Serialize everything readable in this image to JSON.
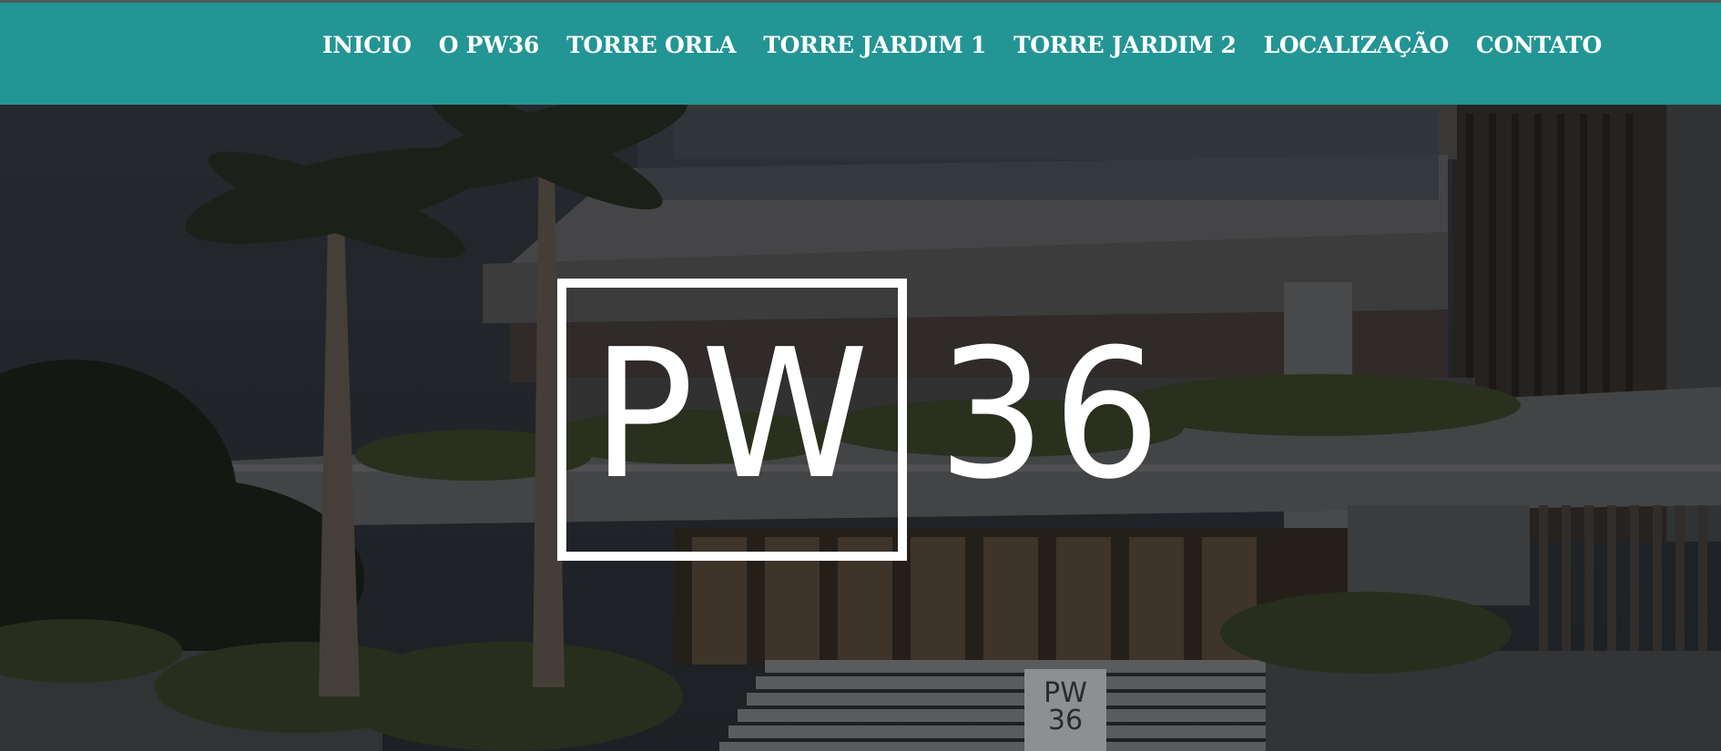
{
  "nav": {
    "items": [
      {
        "label": "INICIO"
      },
      {
        "label": "O PW36"
      },
      {
        "label": "TORRE ORLA"
      },
      {
        "label": "TORRE JARDIM 1"
      },
      {
        "label": "TORRE JARDIM 2"
      },
      {
        "label": "LOCALIZAÇÃO"
      },
      {
        "label": "CONTATO"
      }
    ]
  },
  "hero": {
    "logo_left": "PW",
    "logo_right": "36",
    "sign_line1": "PW",
    "sign_line2": "36"
  },
  "colors": {
    "header_bg": "#229594",
    "nav_text": "#ffffff",
    "overlay": "#000000"
  }
}
